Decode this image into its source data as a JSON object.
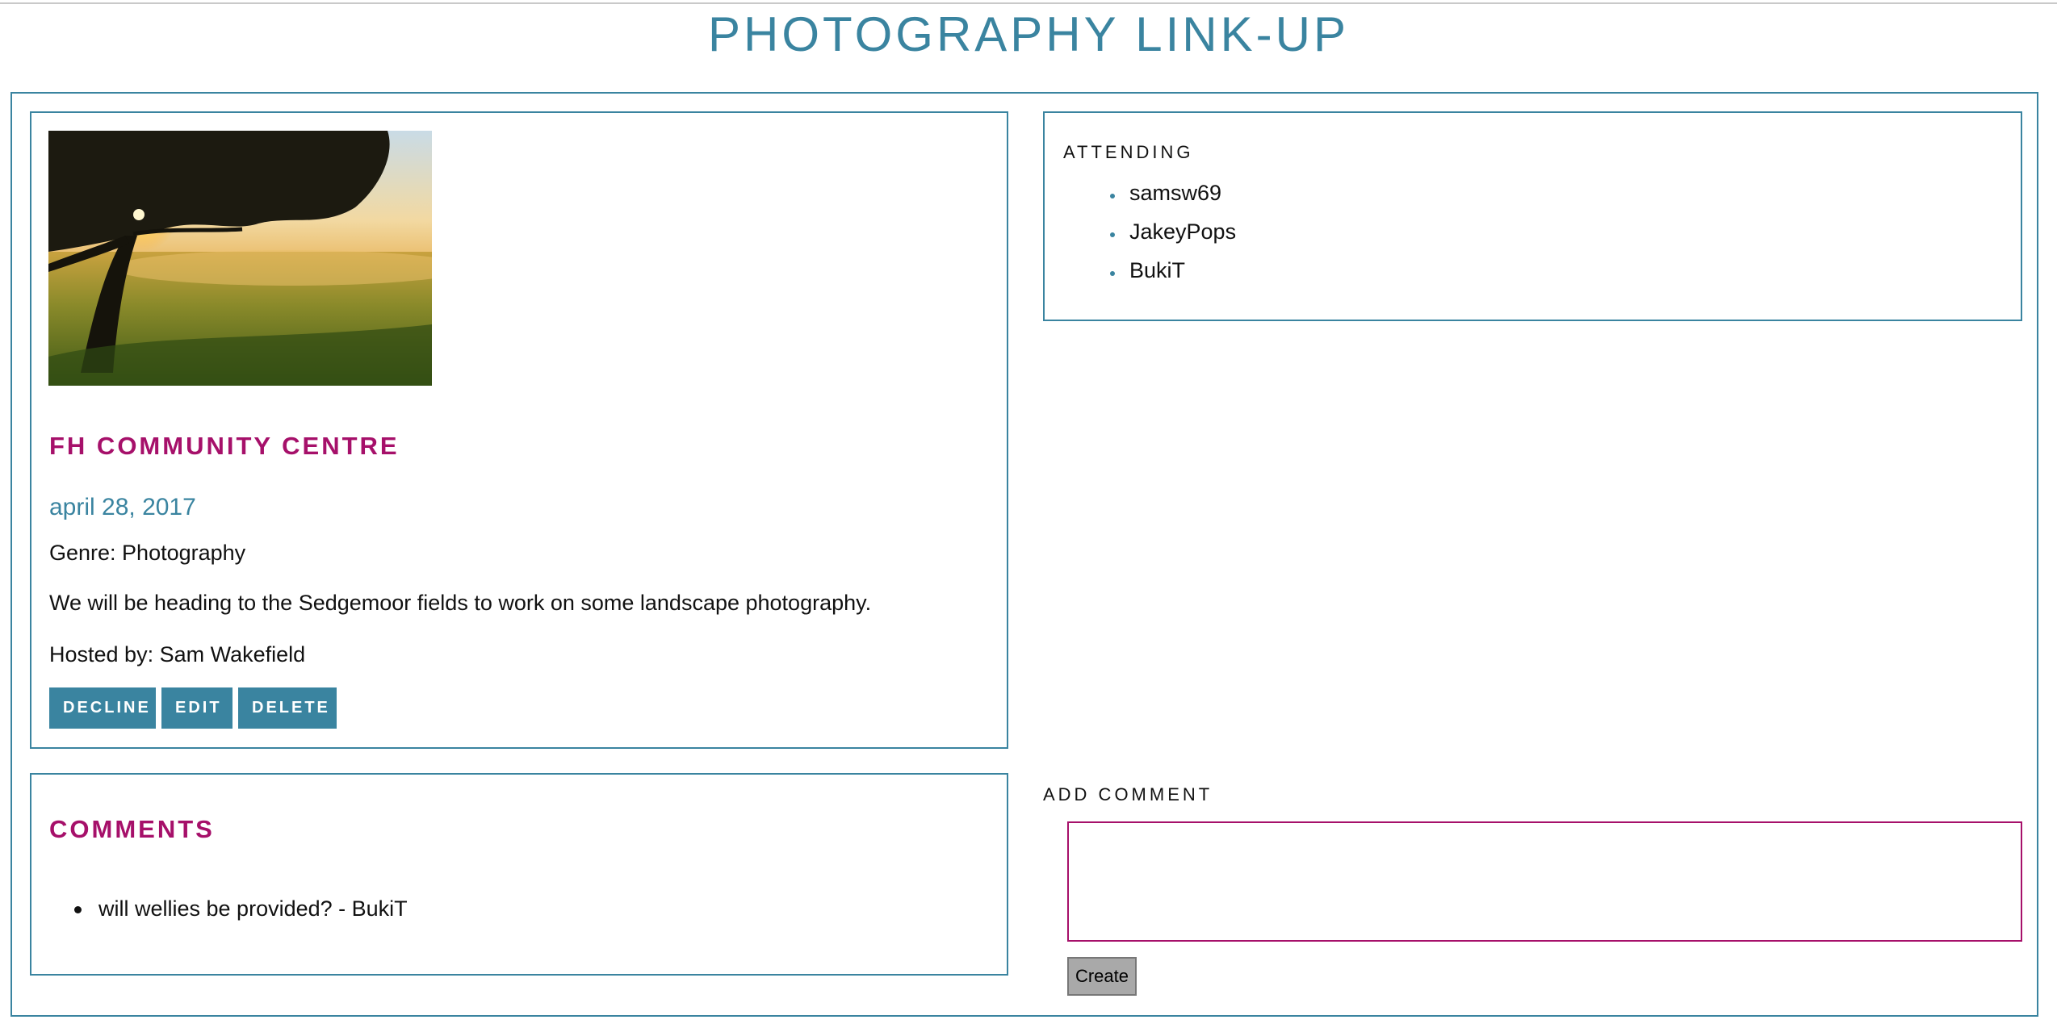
{
  "site": {
    "title": "PHOTOGRAPHY LINK-UP"
  },
  "event": {
    "image": "landscape-photo-tree-sunset-field",
    "venue": "FH COMMUNITY CENTRE",
    "date": "april 28, 2017",
    "genre": "Genre: Photography",
    "description": "We will be heading to the Sedgemoor fields to work on some landscape photography.",
    "host": "Hosted by: Sam Wakefield",
    "buttons": {
      "decline": "DECLINE",
      "edit": "EDIT",
      "delete": "DELETE"
    }
  },
  "attending": {
    "heading": "ATTENDING",
    "users": [
      "samsw69",
      "JakeyPops",
      "BukiT"
    ]
  },
  "comments": {
    "heading": "COMMENTS",
    "items": [
      "will wellies be provided? - BukiT"
    ]
  },
  "add_comment": {
    "label": "ADD COMMENT",
    "value": "",
    "button": "Create"
  },
  "colors": {
    "accent": "#3a84a0",
    "highlight": "#a6106a"
  }
}
